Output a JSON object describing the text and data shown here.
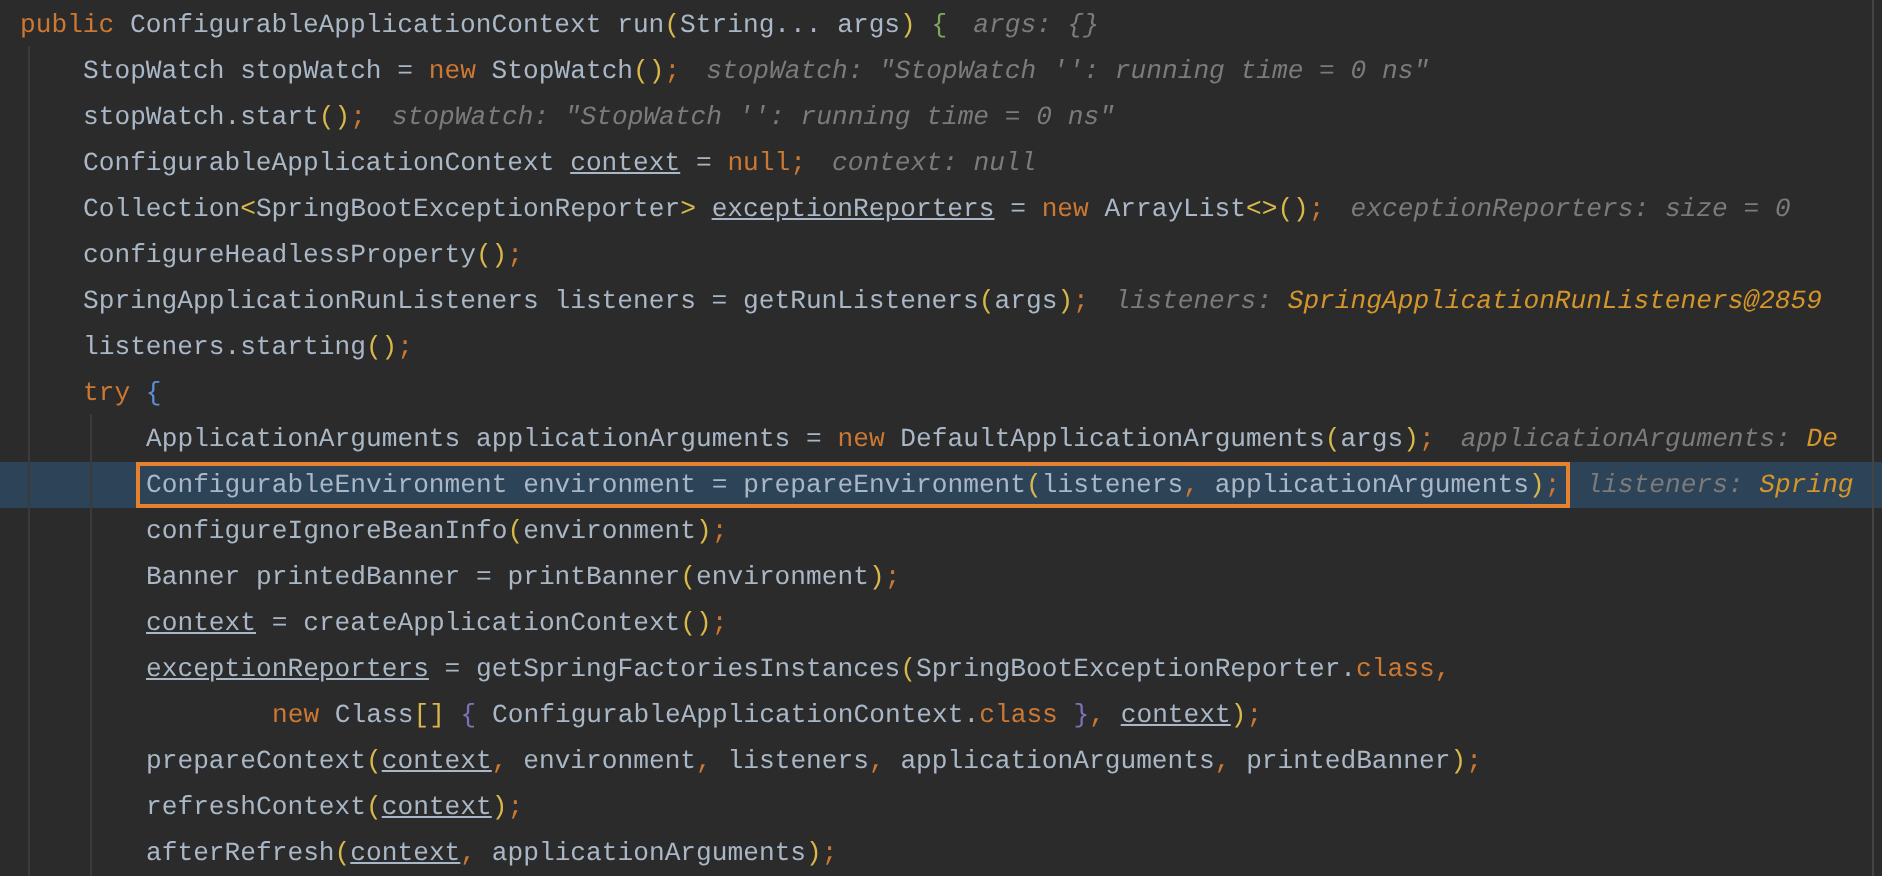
{
  "editor": {
    "lines": [
      {
        "kind": "signature",
        "segments": [
          {
            "text": "public",
            "kind": "keyword"
          },
          {
            "text": " ConfigurableApplicationContext run",
            "kind": "plain"
          },
          {
            "text": "(",
            "kind": "bracket",
            "color": "#d9b84a"
          },
          {
            "text": "String... args",
            "kind": "plain"
          },
          {
            "text": ")",
            "kind": "bracket",
            "color": "#d9b84a"
          },
          {
            "text": " {",
            "kind": "bracket",
            "color": "#7fa75b"
          }
        ],
        "hint": {
          "name": "args:",
          "value": "{}",
          "kind": "plain"
        },
        "current": false,
        "boxed": false
      },
      {
        "kind": "statement",
        "segments": [
          {
            "text": "StopWatch stopWatch = ",
            "kind": "plain"
          },
          {
            "text": "new",
            "kind": "keyword"
          },
          {
            "text": " StopWatch",
            "kind": "plain"
          },
          {
            "text": "()",
            "kind": "bracket",
            "color": "#d9b84a"
          },
          {
            "text": ";",
            "kind": "keyword"
          }
        ],
        "hint": {
          "name": "stopWatch:",
          "value": "\"StopWatch '': running time = 0 ns\"",
          "kind": "plain"
        },
        "current": false,
        "boxed": false
      },
      {
        "kind": "statement",
        "segments": [
          {
            "text": "stopWatch.start",
            "kind": "plain"
          },
          {
            "text": "()",
            "kind": "bracket",
            "color": "#d9b84a"
          },
          {
            "text": ";",
            "kind": "keyword"
          }
        ],
        "hint": {
          "name": "stopWatch:",
          "value": "\"StopWatch '': running time = 0 ns\"",
          "kind": "plain"
        },
        "current": false,
        "boxed": false
      },
      {
        "kind": "statement",
        "segments": [
          {
            "text": "ConfigurableApplicationContext ",
            "kind": "plain"
          },
          {
            "text": "context",
            "kind": "reassigned"
          },
          {
            "text": " = ",
            "kind": "plain"
          },
          {
            "text": "null;",
            "kind": "keyword"
          }
        ],
        "hint": {
          "name": "context:",
          "value": "null",
          "kind": "plain"
        },
        "current": false,
        "boxed": false
      },
      {
        "kind": "statement",
        "segments": [
          {
            "text": "Collection",
            "kind": "plain"
          },
          {
            "text": "<",
            "kind": "bracket",
            "color": "#d9b84a"
          },
          {
            "text": "SpringBootExceptionReporter",
            "kind": "plain"
          },
          {
            "text": "> ",
            "kind": "bracket",
            "color": "#d9b84a"
          },
          {
            "text": "exceptionReporters",
            "kind": "reassigned"
          },
          {
            "text": " = ",
            "kind": "plain"
          },
          {
            "text": "new",
            "kind": "keyword"
          },
          {
            "text": " ArrayList",
            "kind": "plain"
          },
          {
            "text": "<>()",
            "kind": "bracket",
            "color": "#d9b84a"
          },
          {
            "text": ";",
            "kind": "keyword"
          }
        ],
        "hint": {
          "name": "exceptionReporters:",
          "value": "size = 0",
          "kind": "plain"
        },
        "current": false,
        "boxed": false
      },
      {
        "kind": "statement",
        "segments": [
          {
            "text": "configureHeadlessProperty",
            "kind": "plain"
          },
          {
            "text": "()",
            "kind": "bracket",
            "color": "#d9b84a"
          },
          {
            "text": ";",
            "kind": "keyword"
          }
        ],
        "current": false,
        "boxed": false
      },
      {
        "kind": "statement",
        "segments": [
          {
            "text": "SpringApplicationRunListeners listeners = getRunListeners",
            "kind": "plain"
          },
          {
            "text": "(",
            "kind": "bracket",
            "color": "#d9b84a"
          },
          {
            "text": "args",
            "kind": "plain"
          },
          {
            "text": ")",
            "kind": "bracket",
            "color": "#d9b84a"
          },
          {
            "text": ";",
            "kind": "keyword"
          }
        ],
        "hint": {
          "name": "listeners:",
          "value": "SpringApplicationRunListeners@2859",
          "kind": "object"
        },
        "current": false,
        "boxed": false
      },
      {
        "kind": "statement",
        "segments": [
          {
            "text": "listeners.starting",
            "kind": "plain"
          },
          {
            "text": "()",
            "kind": "bracket",
            "color": "#d9b84a"
          },
          {
            "text": ";",
            "kind": "keyword"
          }
        ],
        "current": false,
        "boxed": false
      },
      {
        "kind": "statement",
        "segments": [
          {
            "text": "try",
            "kind": "keyword"
          },
          {
            "text": " {",
            "kind": "bracket",
            "color": "#5c8fd6"
          }
        ],
        "current": false,
        "boxed": false
      },
      {
        "kind": "nested",
        "segments": [
          {
            "text": "ApplicationArguments applicationArguments = ",
            "kind": "plain"
          },
          {
            "text": "new",
            "kind": "keyword"
          },
          {
            "text": " DefaultApplicationArguments",
            "kind": "plain"
          },
          {
            "text": "(",
            "kind": "bracket",
            "color": "#d9b84a"
          },
          {
            "text": "args",
            "kind": "plain"
          },
          {
            "text": ")",
            "kind": "bracket",
            "color": "#d9b84a"
          },
          {
            "text": ";",
            "kind": "keyword"
          }
        ],
        "hint": {
          "name": "applicationArguments:",
          "value": "De",
          "kind": "object"
        },
        "current": false,
        "boxed": false
      },
      {
        "kind": "nested",
        "segments": [
          {
            "text": "ConfigurableEnvironment environment = prepareEnvironment",
            "kind": "plain"
          },
          {
            "text": "(",
            "kind": "bracket",
            "color": "#d9b84a"
          },
          {
            "text": "listeners",
            "kind": "plain"
          },
          {
            "text": ",",
            "kind": "keyword"
          },
          {
            "text": " applicationArguments",
            "kind": "plain"
          },
          {
            "text": ")",
            "kind": "bracket",
            "color": "#d9b84a"
          },
          {
            "text": ";",
            "kind": "keyword"
          }
        ],
        "hint": {
          "name": "listeners:",
          "value": "Spring",
          "kind": "object"
        },
        "current": true,
        "boxed": true
      },
      {
        "kind": "nested",
        "segments": [
          {
            "text": "configureIgnoreBeanInfo",
            "kind": "plain"
          },
          {
            "text": "(",
            "kind": "bracket",
            "color": "#d9b84a"
          },
          {
            "text": "environment",
            "kind": "plain"
          },
          {
            "text": ")",
            "kind": "bracket",
            "color": "#d9b84a"
          },
          {
            "text": ";",
            "kind": "keyword"
          }
        ],
        "current": false,
        "boxed": false
      },
      {
        "kind": "nested",
        "segments": [
          {
            "text": "Banner printedBanner = printBanner",
            "kind": "plain"
          },
          {
            "text": "(",
            "kind": "bracket",
            "color": "#d9b84a"
          },
          {
            "text": "environment",
            "kind": "plain"
          },
          {
            "text": ")",
            "kind": "bracket",
            "color": "#d9b84a"
          },
          {
            "text": ";",
            "kind": "keyword"
          }
        ],
        "current": false,
        "boxed": false
      },
      {
        "kind": "nested",
        "segments": [
          {
            "text": "context",
            "kind": "reassigned"
          },
          {
            "text": " = createApplicationContext",
            "kind": "plain"
          },
          {
            "text": "()",
            "kind": "bracket",
            "color": "#d9b84a"
          },
          {
            "text": ";",
            "kind": "keyword"
          }
        ],
        "current": false,
        "boxed": false
      },
      {
        "kind": "nested",
        "segments": [
          {
            "text": "exceptionReporters",
            "kind": "reassigned"
          },
          {
            "text": " = getSpringFactoriesInstances",
            "kind": "plain"
          },
          {
            "text": "(",
            "kind": "bracket",
            "color": "#d9b84a"
          },
          {
            "text": "SpringBootExceptionReporter.",
            "kind": "plain"
          },
          {
            "text": "class,",
            "kind": "keyword"
          }
        ],
        "current": false,
        "boxed": false
      },
      {
        "kind": "continuation",
        "segments": [
          {
            "text": "new",
            "kind": "keyword"
          },
          {
            "text": " Class",
            "kind": "plain"
          },
          {
            "text": "[]",
            "kind": "bracket",
            "color": "#d9b84a"
          },
          {
            "text": " {",
            "kind": "bracket",
            "color": "#7f73b8"
          },
          {
            "text": " ConfigurableApplicationContext.",
            "kind": "plain"
          },
          {
            "text": "class",
            "kind": "keyword"
          },
          {
            "text": " }",
            "kind": "bracket",
            "color": "#7f73b8"
          },
          {
            "text": ", ",
            "kind": "keyword"
          },
          {
            "text": "context",
            "kind": "reassigned"
          },
          {
            "text": ")",
            "kind": "bracket",
            "color": "#d9b84a"
          },
          {
            "text": ";",
            "kind": "keyword"
          }
        ],
        "current": false,
        "boxed": false
      },
      {
        "kind": "nested",
        "segments": [
          {
            "text": "prepareContext",
            "kind": "plain"
          },
          {
            "text": "(",
            "kind": "bracket",
            "color": "#d9b84a"
          },
          {
            "text": "context",
            "kind": "reassigned"
          },
          {
            "text": ",",
            "kind": "keyword"
          },
          {
            "text": " environment",
            "kind": "plain"
          },
          {
            "text": ",",
            "kind": "keyword"
          },
          {
            "text": " listeners",
            "kind": "plain"
          },
          {
            "text": ",",
            "kind": "keyword"
          },
          {
            "text": " applicationArguments",
            "kind": "plain"
          },
          {
            "text": ",",
            "kind": "keyword"
          },
          {
            "text": " printedBanner",
            "kind": "plain"
          },
          {
            "text": ")",
            "kind": "bracket",
            "color": "#d9b84a"
          },
          {
            "text": ";",
            "kind": "keyword"
          }
        ],
        "current": false,
        "boxed": false
      },
      {
        "kind": "nested",
        "segments": [
          {
            "text": "refreshContext",
            "kind": "plain"
          },
          {
            "text": "(",
            "kind": "bracket",
            "color": "#d9b84a"
          },
          {
            "text": "context",
            "kind": "reassigned"
          },
          {
            "text": ")",
            "kind": "bracket",
            "color": "#d9b84a"
          },
          {
            "text": ";",
            "kind": "keyword"
          }
        ],
        "current": false,
        "boxed": false
      },
      {
        "kind": "nested",
        "segments": [
          {
            "text": "afterRefresh",
            "kind": "plain"
          },
          {
            "text": "(",
            "kind": "bracket",
            "color": "#d9b84a"
          },
          {
            "text": "context",
            "kind": "reassigned"
          },
          {
            "text": ",",
            "kind": "keyword"
          },
          {
            "text": " applicationArguments",
            "kind": "plain"
          },
          {
            "text": ")",
            "kind": "bracket",
            "color": "#d9b84a"
          },
          {
            "text": ";",
            "kind": "keyword"
          }
        ],
        "current": false,
        "boxed": false
      }
    ]
  }
}
